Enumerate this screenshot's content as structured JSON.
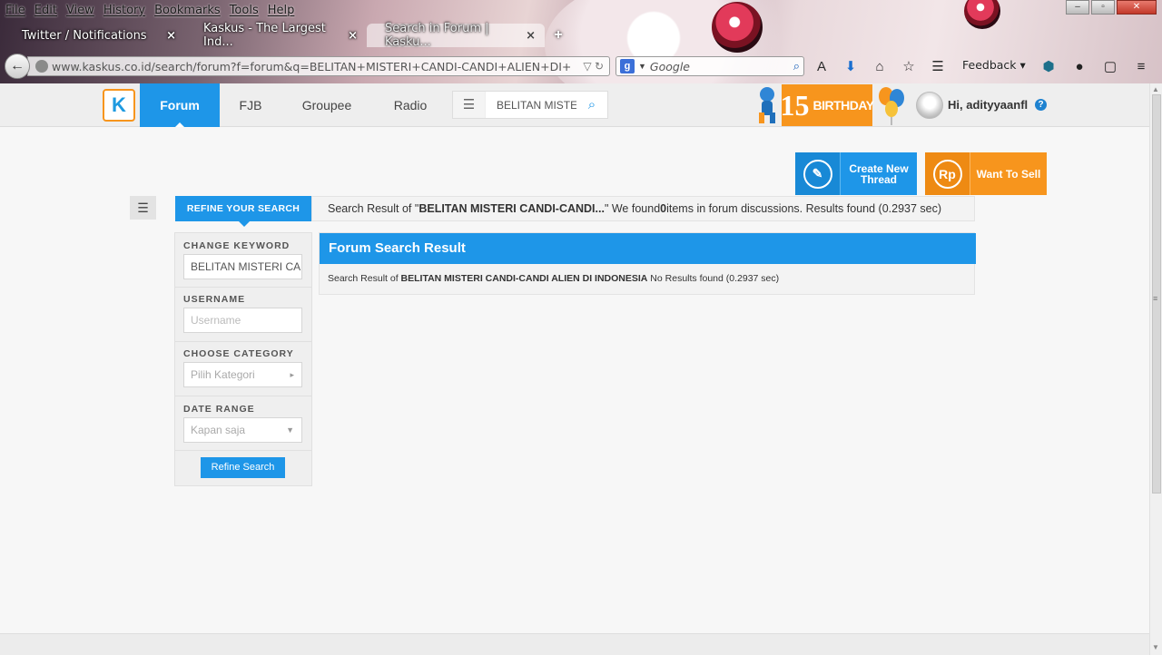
{
  "browser": {
    "menu": [
      "File",
      "Edit",
      "View",
      "History",
      "Bookmarks",
      "Tools",
      "Help"
    ],
    "tabs": [
      {
        "title": "Twitter / Notifications"
      },
      {
        "title": "Kaskus - The Largest Ind..."
      },
      {
        "title": "Search in Forum | Kasku..."
      }
    ],
    "new_tab": "+",
    "url_host": "www.kaskus.co.id",
    "url_path": "/search/forum?f=forum&q=BELITAN+MISTERI+CANDI-CANDI+ALIEN+DI+",
    "search_placeholder": "Google",
    "feedback": "Feedback"
  },
  "header": {
    "logo": "K",
    "nav": [
      {
        "label": "Forum",
        "active": true
      },
      {
        "label": "FJB"
      },
      {
        "label": "Groupee"
      },
      {
        "label": "Radio"
      }
    ],
    "search_value": "BELITAN MISTERI",
    "birthday_number": "15",
    "birthday_text": "BIRTHDAY",
    "greeting": "Hi, adityyaanfl",
    "help": "?"
  },
  "actions": {
    "create_thread": "Create New Thread",
    "want_to_sell": "Want To Sell",
    "sell_icon": "Rp"
  },
  "refine": {
    "header": "REFINE YOUR SEARCH",
    "keyword_label": "CHANGE KEYWORD",
    "keyword_value": "BELITAN MISTERI CA",
    "username_label": "USERNAME",
    "username_placeholder": "Username",
    "category_label": "CHOOSE CATEGORY",
    "category_value": "Pilih Kategori",
    "date_label": "DATE RANGE",
    "date_value": "Kapan saja",
    "button": "Refine Search"
  },
  "results": {
    "bar_prefix": "Search Result of \"",
    "bar_query": "BELITAN MISTERI CANDI-CANDI...",
    "bar_mid": "\" We found ",
    "bar_count": "0",
    "bar_suffix": " items in forum discussions. Results found (0.2937 sec)",
    "panel_title": "Forum Search Result",
    "line_prefix": "Search Result of ",
    "line_query": "BELITAN MISTERI CANDI-CANDI ALIEN DI INDONESIA",
    "line_suffix": " No Results found (0.2937 sec)"
  },
  "colors": {
    "kaskus_blue": "#1e96e8",
    "kaskus_orange": "#f7951d"
  }
}
